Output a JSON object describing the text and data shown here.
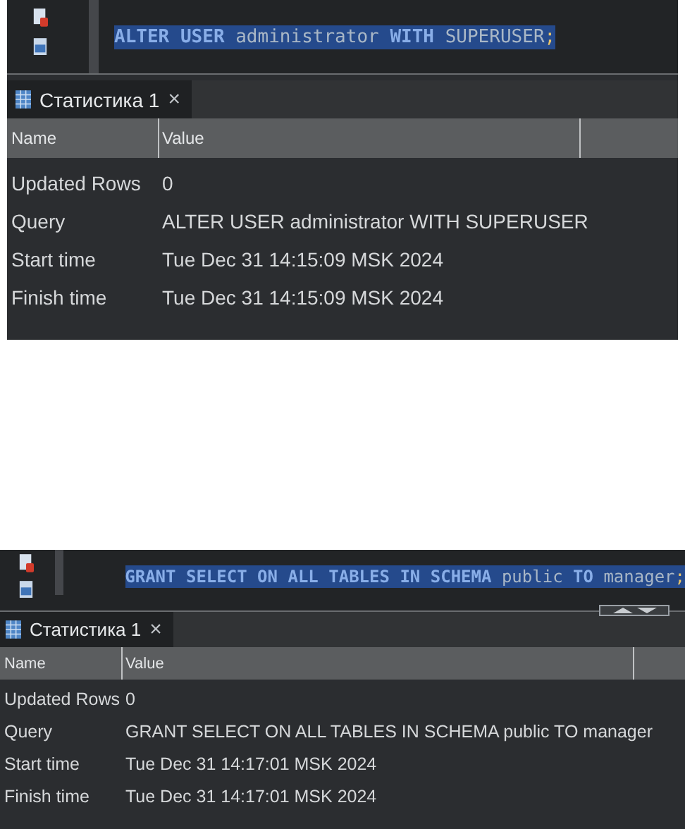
{
  "panels": [
    {
      "code": [
        {
          "kind": "keyword",
          "text": "ALTER USER"
        },
        {
          "kind": "ident",
          "text": " administrator "
        },
        {
          "kind": "keyword",
          "text": "WITH"
        },
        {
          "kind": "ident",
          "text": " SUPERUSER"
        },
        {
          "kind": "punct",
          "text": ";"
        }
      ],
      "editor_arrows": false,
      "tab": {
        "label": "Статистика 1",
        "close": "×",
        "selected": true
      },
      "columns": [
        "Name",
        "Value"
      ],
      "rows": [
        {
          "name": "Updated Rows",
          "value": "0"
        },
        {
          "name": "Query",
          "value": "ALTER USER administrator WITH SUPERUSER"
        },
        {
          "name": "Start time",
          "value": "Tue Dec 31 14:15:09 MSK 2024"
        },
        {
          "name": "Finish time",
          "value": "Tue Dec 31 14:15:09 MSK 2024"
        }
      ]
    },
    {
      "code": [
        {
          "kind": "keyword",
          "text": "GRANT SELECT ON ALL TABLES IN SCHEMA"
        },
        {
          "kind": "ident",
          "text": " public "
        },
        {
          "kind": "keyword",
          "text": "TO"
        },
        {
          "kind": "ident",
          "text": " manager"
        },
        {
          "kind": "punct",
          "text": ";"
        }
      ],
      "editor_arrows": true,
      "tab": {
        "label": "Статистика 1",
        "close": "×",
        "selected": true
      },
      "columns": [
        "Name",
        "Value"
      ],
      "rows": [
        {
          "name": "Updated Rows",
          "value": "0"
        },
        {
          "name": "Query",
          "value": "GRANT SELECT ON ALL TABLES IN SCHEMA public TO manager"
        },
        {
          "name": "Start time",
          "value": "Tue Dec 31 14:17:01 MSK 2024"
        },
        {
          "name": "Finish time",
          "value": "Tue Dec 31 14:17:01 MSK 2024"
        }
      ]
    }
  ]
}
